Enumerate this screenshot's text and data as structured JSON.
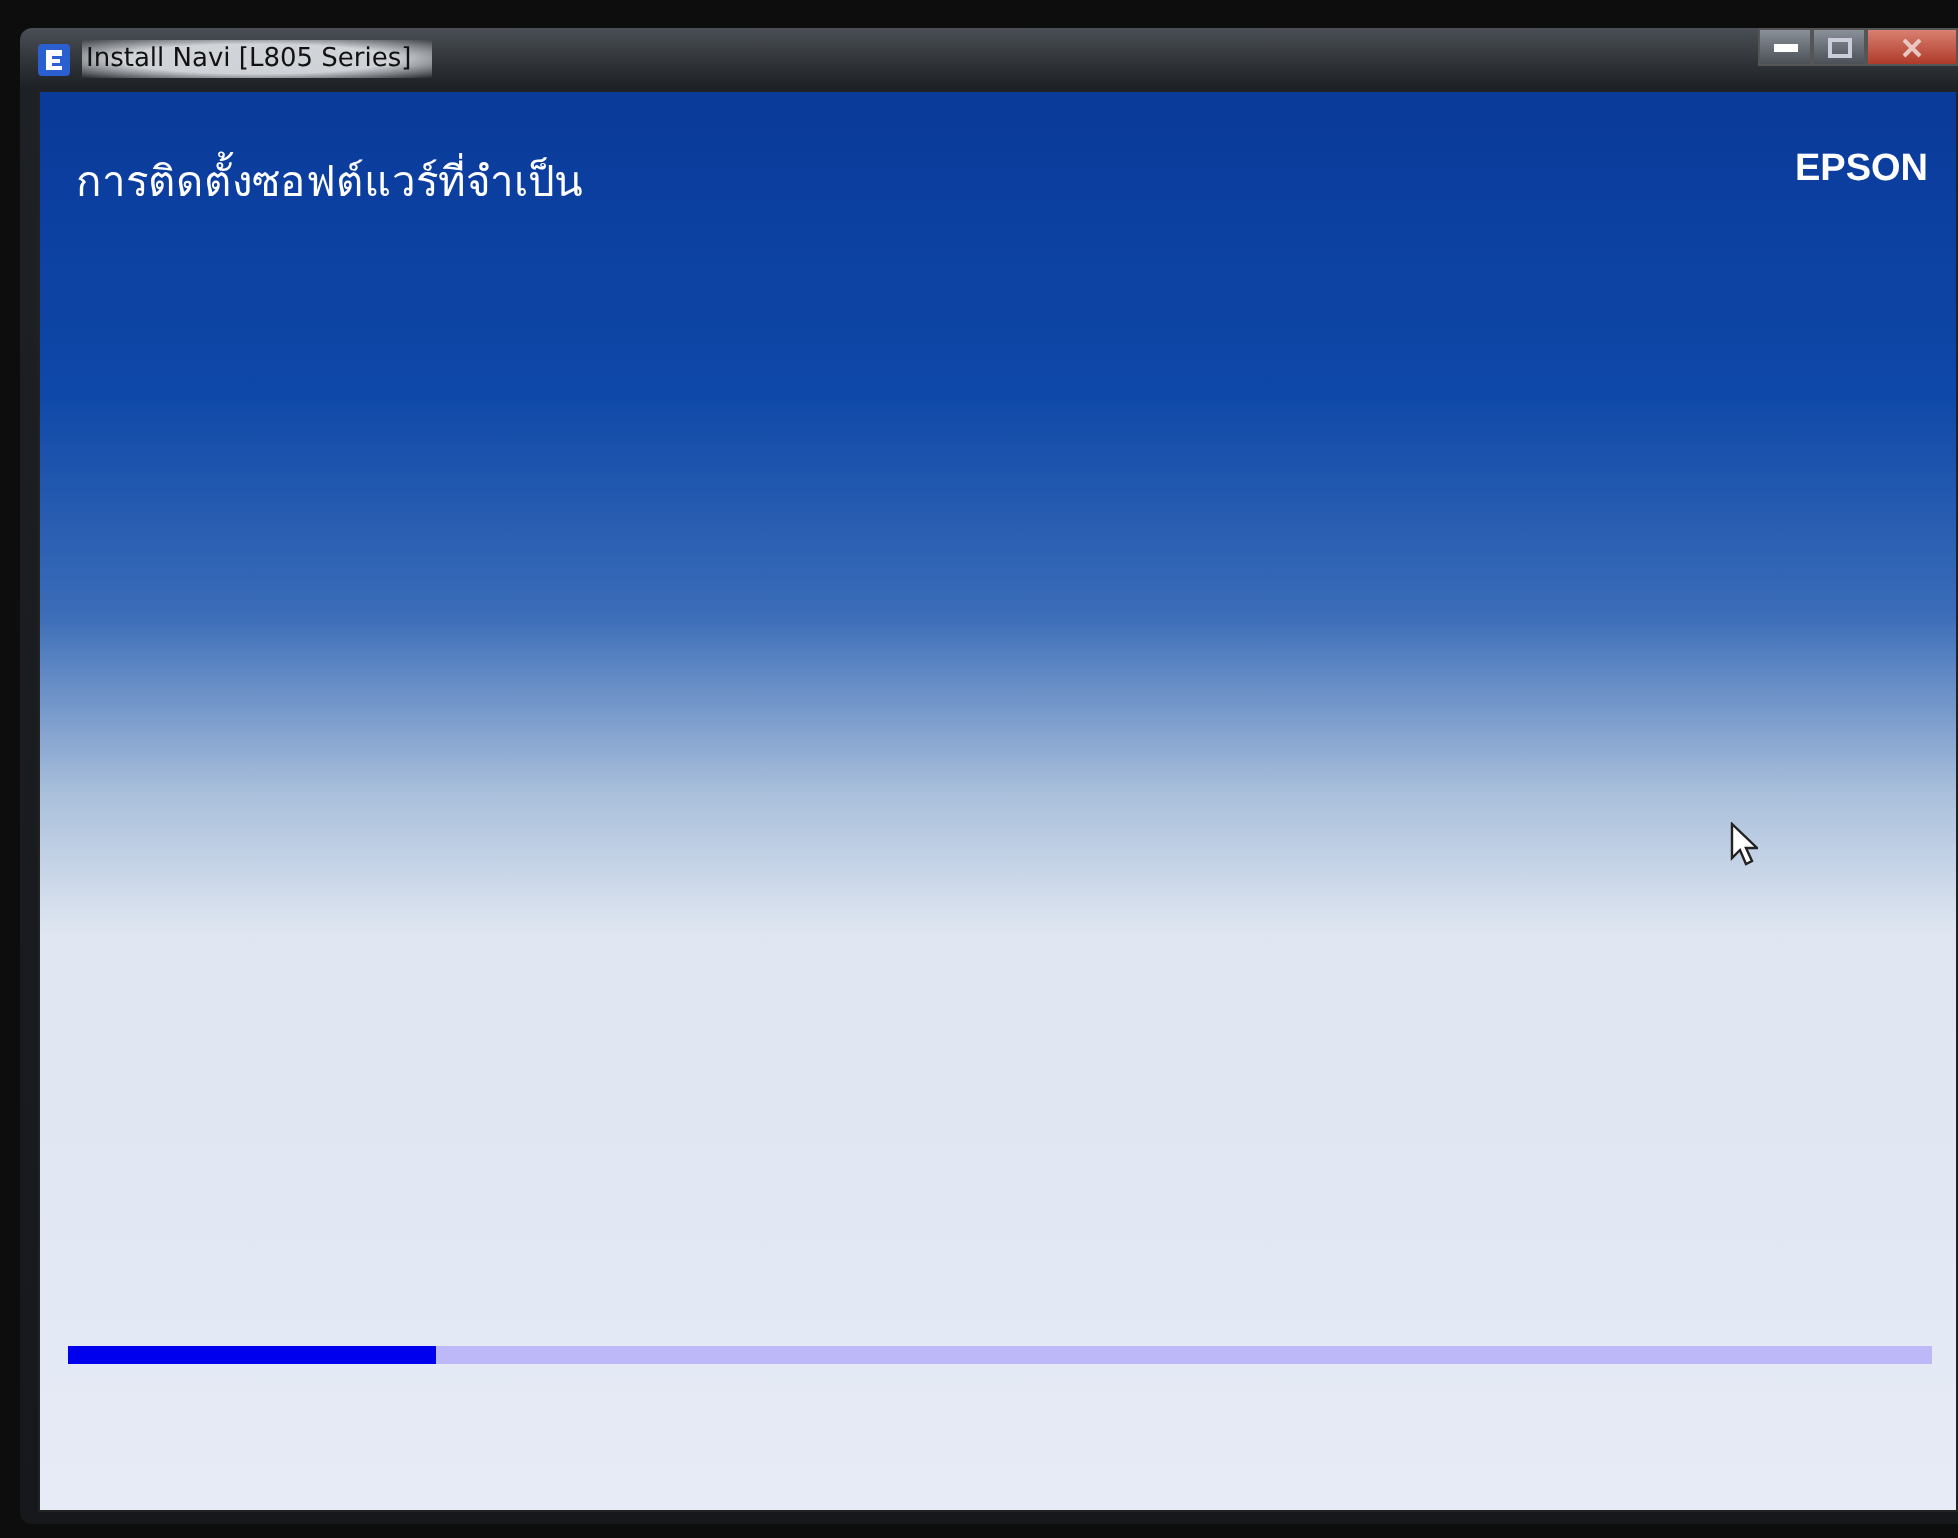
{
  "window": {
    "title": "Install Navi [L805 Series]"
  },
  "header": {
    "title": "การติดตั้งซอฟต์แวร์ที่จำเป็น",
    "logo": "EPSON"
  },
  "progress": {
    "level": 0.197
  }
}
